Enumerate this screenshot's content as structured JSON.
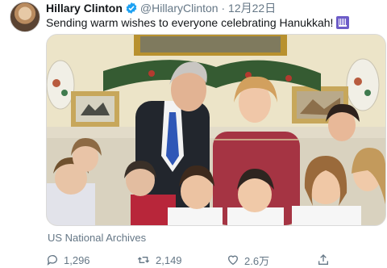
{
  "tweet": {
    "author_name": "Hillary Clinton",
    "handle": "@HillaryClinton",
    "separator": "·",
    "date": "12月22日",
    "text": "Sending warm wishes to everyone celebrating Hanukkah!",
    "emoji_icon": "menorah-emoji-icon",
    "media_caption": "US National Archives",
    "replies": "1,296",
    "retweets": "2,149",
    "likes": "2.6万"
  },
  "colors": {
    "verified": "#1da1f2",
    "muted": "#657786",
    "text": "#14171a"
  }
}
